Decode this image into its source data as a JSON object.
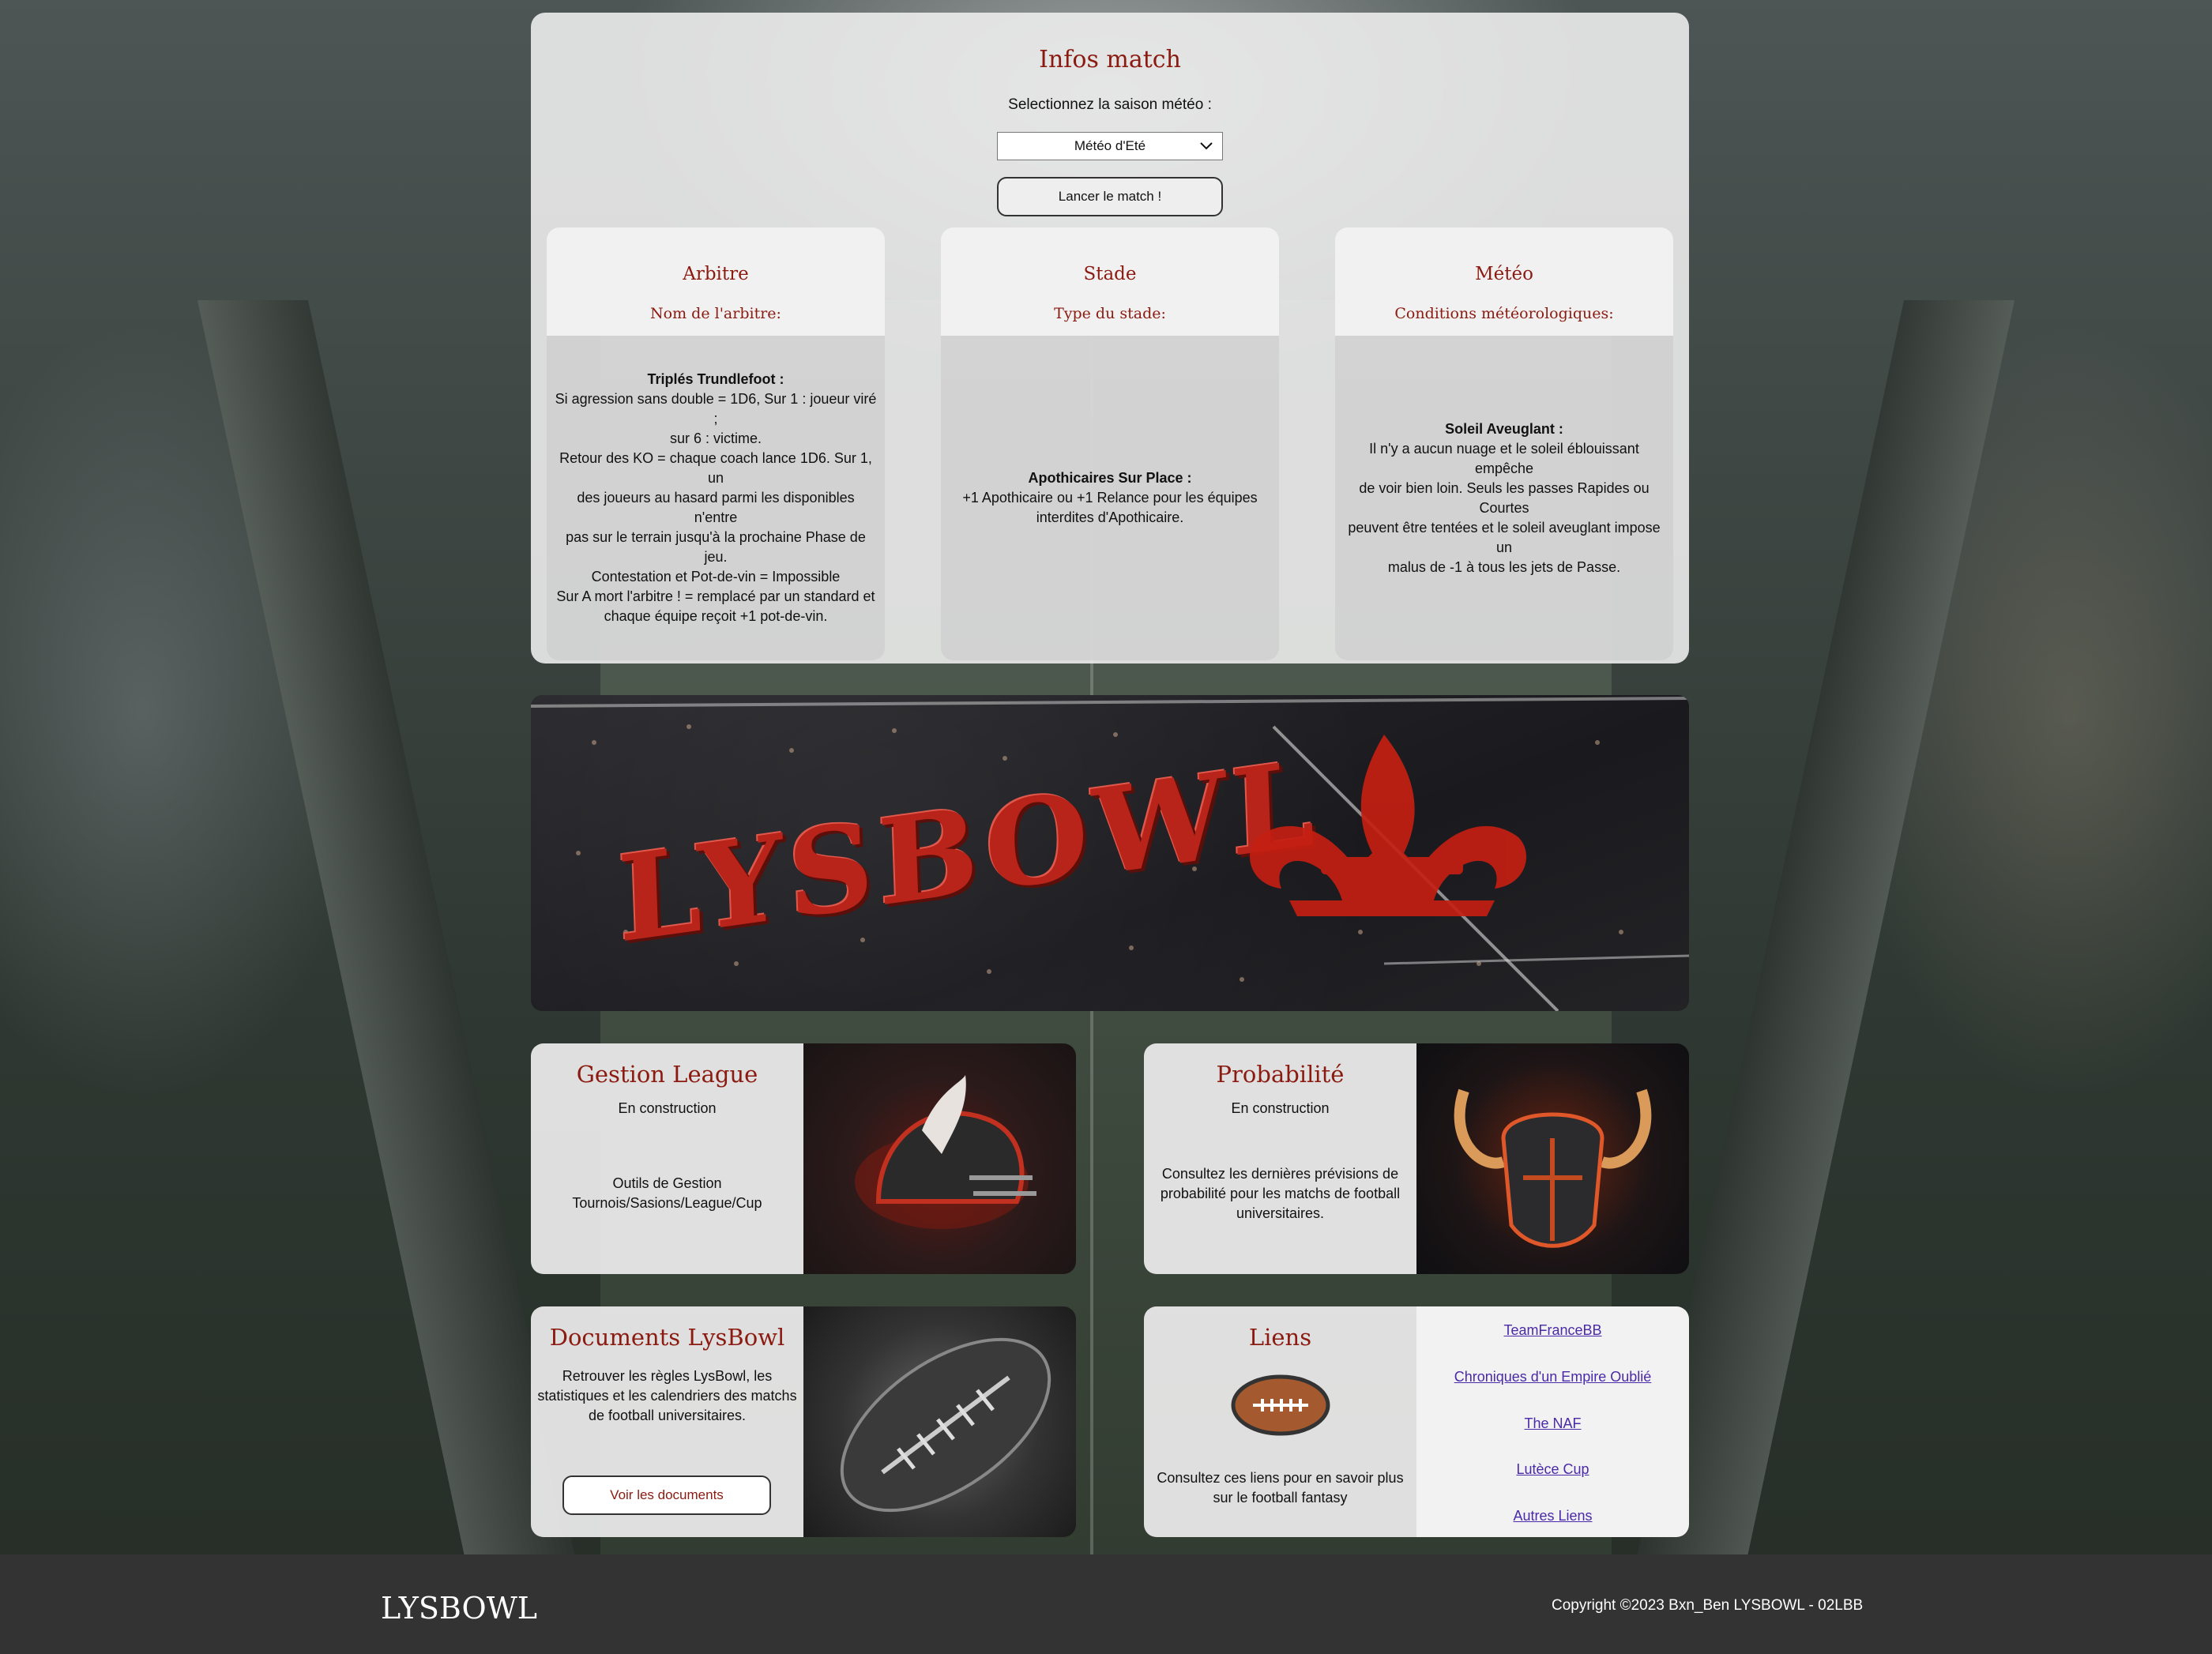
{
  "infos": {
    "title": "Infos match",
    "season_label": "Selectionnez la saison météo :",
    "season_selected": "Météo d'Eté",
    "launch_button": "Lancer le match !"
  },
  "cards": [
    {
      "title": "Arbitre",
      "subtitle": "Nom de l'arbitre:",
      "name": "Triplés Trundlefoot :",
      "lines": [
        "Si agression sans double = 1D6, Sur 1 : joueur viré ;",
        "sur 6 : victime.",
        "Retour des KO = chaque coach lance 1D6. Sur 1, un",
        "des joueurs au hasard parmi les disponibles n'entre",
        "pas sur le terrain jusqu'à la prochaine Phase de jeu.",
        "Contestation et Pot-de-vin = Impossible",
        "Sur A mort l'arbitre ! = remplacé par un standard et",
        "chaque équipe reçoit +1 pot-de-vin."
      ]
    },
    {
      "title": "Stade",
      "subtitle": "Type du stade:",
      "name": "Apothicaires Sur Place :",
      "lines": [
        "+1 Apothicaire ou +1 Relance pour les équipes",
        "interdites d'Apothicaire."
      ]
    },
    {
      "title": "Météo",
      "subtitle": "Conditions météorologiques:",
      "name": "Soleil Aveuglant :",
      "lines": [
        "Il n'y a aucun nuage et le soleil éblouissant empêche",
        "de voir bien loin. Seuls les passes Rapides ou Courtes",
        "peuvent être tentées et le soleil aveuglant impose un",
        "malus de -1 à tous les jets de Passe."
      ]
    }
  ],
  "banner": {
    "logo_text": "LYSBOWL"
  },
  "gestion": {
    "title": "Gestion League",
    "status": "En construction",
    "desc_1": "Outils de Gestion",
    "desc_2": "Tournois/Sasions/League/Cup"
  },
  "proba": {
    "title": "Probabilité",
    "status": "En construction",
    "desc_1": "Consultez les dernières prévisions de",
    "desc_2": "probabilité pour les matchs de football",
    "desc_3": "universitaires."
  },
  "docs": {
    "title": "Documents LysBowl",
    "desc_1": "Retrouver les règles LysBowl, les",
    "desc_2": "statistiques et les calendriers des matchs",
    "desc_3": "de football universitaires.",
    "button": "Voir les documents"
  },
  "liens": {
    "title": "Liens",
    "desc_1": "Consultez ces liens pour en savoir plus",
    "desc_2": "sur le football fantasy",
    "links": [
      "TeamFranceBB",
      "Chroniques d'un Empire Oublié",
      "The NAF",
      "Lutèce Cup",
      "Autres Liens"
    ]
  },
  "footer": {
    "brand": "LYSBOWL",
    "copyright": "Copyright ©2023 Bxn_Ben LYSBOWL - 02LBB"
  },
  "colors": {
    "accent": "#8b1a10",
    "link": "#4a2aa8",
    "footer_bg": "#333333"
  }
}
